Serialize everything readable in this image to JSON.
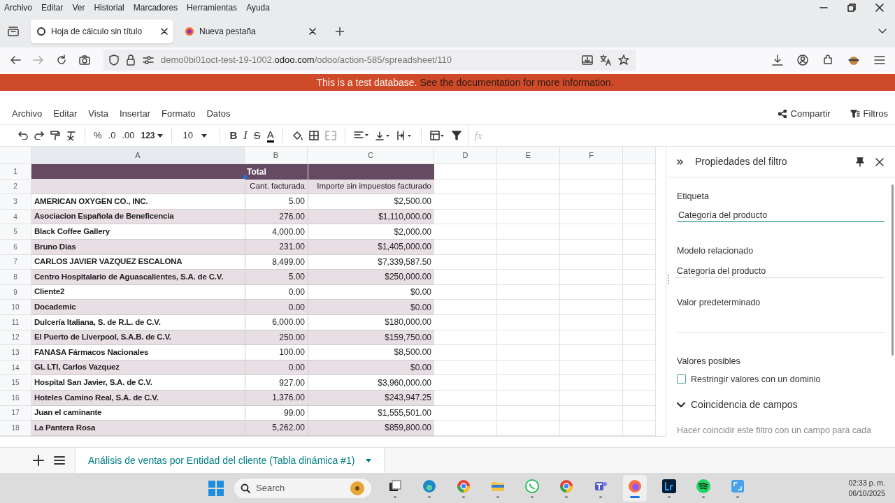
{
  "browser": {
    "menu": [
      "Archivo",
      "Editar",
      "Ver",
      "Historial",
      "Marcadores",
      "Herramientas",
      "Ayuda"
    ],
    "tabs": [
      {
        "title": "Hoja de cálculo sin título",
        "selected": true
      },
      {
        "title": "Nueva pestaña",
        "selected": false
      }
    ],
    "url": {
      "host_start": "demo0bi01oct-test-19-1002.",
      "domain": "odoo.com",
      "path": "/odoo/action-585/spreadsheet/110"
    }
  },
  "banner": {
    "text": "This is a test database.",
    "link": "See the documentation for more information."
  },
  "app_menu": {
    "items": [
      "Archivo",
      "Editar",
      "Vista",
      "Insertar",
      "Formato",
      "Datos"
    ],
    "share": "Compartir",
    "filters": "Filtros"
  },
  "toolbar": {
    "percent": "%",
    "decrease_decimals": ".0",
    "increase_decimals": ".00",
    "number_format": "123",
    "font_size": "10",
    "bold": "B",
    "italic": "I",
    "strikethrough": "S",
    "text_color": "A",
    "formula_prefix": "fx"
  },
  "sheet": {
    "columns": [
      "A",
      "B",
      "C",
      "D",
      "E",
      "F"
    ],
    "header_row_numbers": [
      "1",
      "2"
    ],
    "header_total": "Total",
    "measures": [
      "Cant. facturada",
      "Importe sin impuestos facturado"
    ],
    "rows": [
      {
        "number": "3",
        "customer": "AMERICAN OXYGEN CO., INC.",
        "quantity": "5.00",
        "amount": "$2,500.00"
      },
      {
        "number": "4",
        "customer": "Asociacion Española de Beneficencia",
        "quantity": "276.00",
        "amount": "$1,110,000.00"
      },
      {
        "number": "5",
        "customer": "Black Coffee Gallery",
        "quantity": "4,000.00",
        "amount": "$2,000.00"
      },
      {
        "number": "6",
        "customer": "Bruno Dias",
        "quantity": "231.00",
        "amount": "$1,405,000.00"
      },
      {
        "number": "7",
        "customer": "CARLOS JAVIER VAZQUEZ ESCALONA",
        "quantity": "8,499.00",
        "amount": "$7,339,587.50"
      },
      {
        "number": "8",
        "customer": "Centro Hospitalario de Aguascalientes, S.A. de C.V.",
        "quantity": "5.00",
        "amount": "$250,000.00"
      },
      {
        "number": "9",
        "customer": "Cliente2",
        "quantity": "0.00",
        "amount": "$0.00"
      },
      {
        "number": "10",
        "customer": "Docademic",
        "quantity": "0.00",
        "amount": "$0.00"
      },
      {
        "number": "11",
        "customer": "Dulcería Italiana, S. de R.L. de C.V.",
        "quantity": "6,000.00",
        "amount": "$180,000.00"
      },
      {
        "number": "12",
        "customer": "El Puerto de Liverpool, S.A.B. de C.V.",
        "quantity": "250.00",
        "amount": "$159,750.00"
      },
      {
        "number": "13",
        "customer": "FANASA Fármacos Nacionales",
        "quantity": "100.00",
        "amount": "$8,500.00"
      },
      {
        "number": "14",
        "customer": "GL LTI, Carlos Vazquez",
        "quantity": "0.00",
        "amount": "$0.00"
      },
      {
        "number": "15",
        "customer": "Hospital San Javier, S.A. de C.V.",
        "quantity": "927.00",
        "amount": "$3,960,000.00"
      },
      {
        "number": "16",
        "customer": "Hoteles Camino Real, S.A. de C.V.",
        "quantity": "1,376.00",
        "amount": "$243,947.25"
      },
      {
        "number": "17",
        "customer": "Juan el caminante",
        "quantity": "99.00",
        "amount": "$1,555,501.00"
      },
      {
        "number": "18",
        "customer": "La Pantera Rosa",
        "quantity": "5,262.00",
        "amount": "$859,800.00"
      }
    ]
  },
  "panel": {
    "title": "Propiedades del filtro",
    "label_caption": "Etiqueta",
    "label_value": "Categoría del producto",
    "model_caption": "Modelo relacionado",
    "model_value": "Categoría del producto",
    "default_caption": "Valor predeterminado",
    "values_caption": "Valores posibles",
    "restrict": {
      "label": "Restringir valores con un dominio",
      "checked": false
    },
    "matching": {
      "title": "Coincidencia de campos",
      "expanded": true,
      "description": "Hacer coincidir este filtro con un campo para cada"
    }
  },
  "sheet_tabs": [
    {
      "label": "Análisis de ventas por Entidad del cliente (Tabla dinámica #1)",
      "selected": true
    }
  ],
  "taskbar": {
    "search_placeholder": "Search",
    "time": "02:33 p. m.",
    "date": "06/10/2025",
    "apps": [
      {
        "kind": "taskview",
        "active": false
      },
      {
        "kind": "edge",
        "active": false
      },
      {
        "kind": "chrome",
        "active": false
      },
      {
        "kind": "folder",
        "active": false
      },
      {
        "kind": "whatsapp",
        "active": false
      },
      {
        "kind": "chrome",
        "active": false
      },
      {
        "kind": "teams",
        "active": false
      },
      {
        "kind": "firefox",
        "active": true
      },
      {
        "kind": "lightroom",
        "active": false
      },
      {
        "kind": "spotify",
        "active": false
      },
      {
        "kind": "snip",
        "active": false
      }
    ]
  }
}
